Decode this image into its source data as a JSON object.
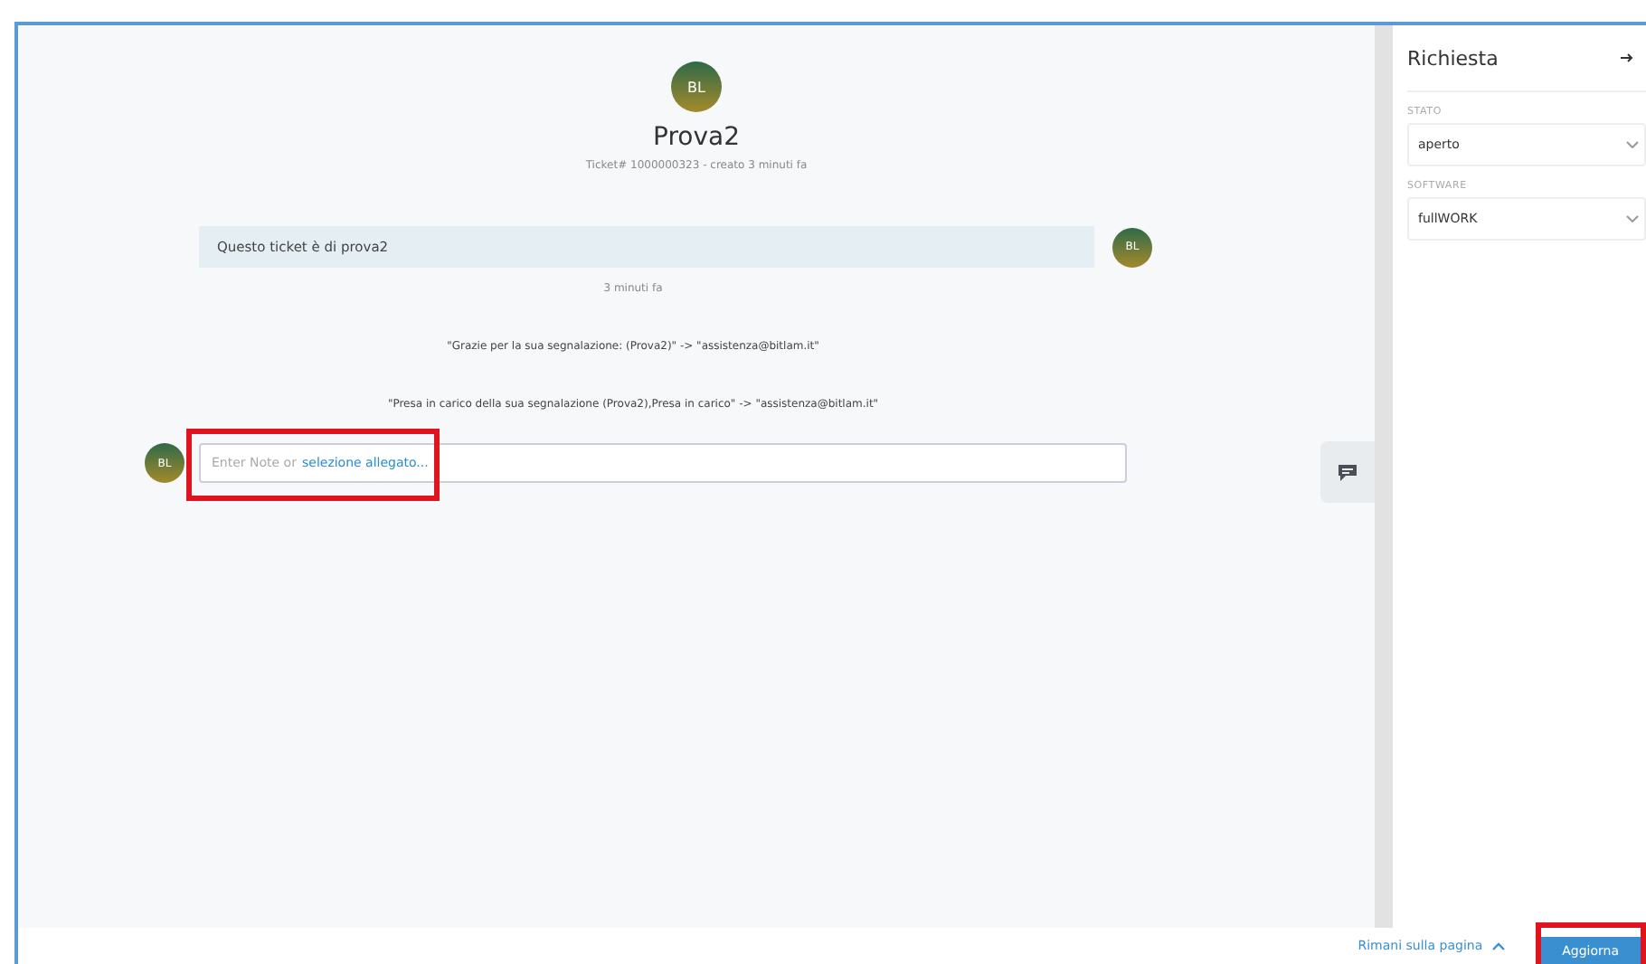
{
  "ticket": {
    "avatar": "BL",
    "title": "Prova2",
    "meta": "Ticket# 1000000323 - creato 3 minuti fa"
  },
  "article": {
    "text": "Questo ticket è di prova2",
    "avatar": "BL",
    "time": "3 minuti fa"
  },
  "notices": [
    "\"Grazie per la sua segnalazione: (Prova2)\" -> \"assistenza@bitlam.it\"",
    "\"Presa in carico della sua segnalazione (Prova2),Presa in carico\" -> \"assistenza@bitlam.it\""
  ],
  "composer": {
    "avatar": "BL",
    "placeholder": "Enter Note or",
    "link": "selezione allegato..."
  },
  "sidebar": {
    "title": "Richiesta",
    "fields": [
      {
        "label": "STATO",
        "value": "aperto"
      },
      {
        "label": "SOFTWARE",
        "value": "fullWORK"
      }
    ]
  },
  "footer": {
    "stay_link": "Rimani sulla pagina",
    "submit": "Aggiorna"
  }
}
